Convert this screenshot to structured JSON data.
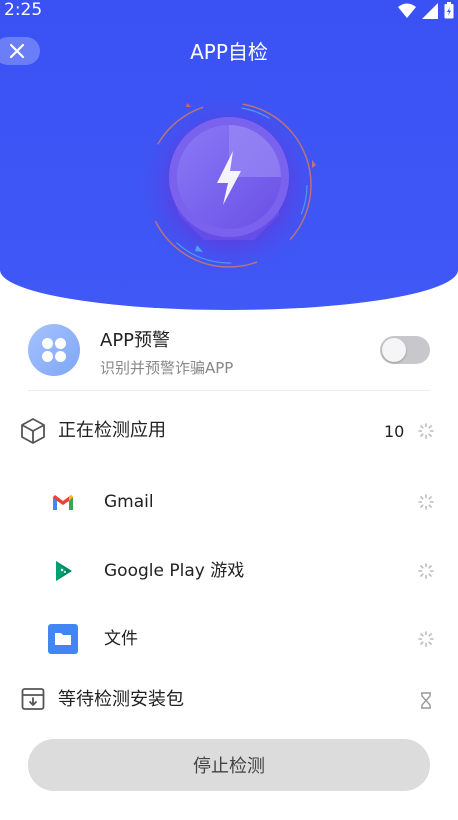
{
  "status_bar": {
    "time": "2:25"
  },
  "header": {
    "title": "APP自检",
    "close_icon": "close-icon"
  },
  "alert": {
    "title": "APP预警",
    "subtitle": "识别并预警诈骗APP",
    "enabled": false
  },
  "scanning": {
    "label": "正在检测应用",
    "count": "10",
    "apps": [
      {
        "name": "Gmail",
        "icon": "gmail-icon"
      },
      {
        "name": "Google Play 游戏",
        "icon": "google-play-games-icon"
      },
      {
        "name": "文件",
        "icon": "files-icon"
      }
    ]
  },
  "waiting": {
    "label": "等待检测安装包"
  },
  "footer": {
    "stop_label": "停止检测"
  },
  "colors": {
    "primary": "#3f58f6",
    "button_bg": "#dcdcdc"
  }
}
